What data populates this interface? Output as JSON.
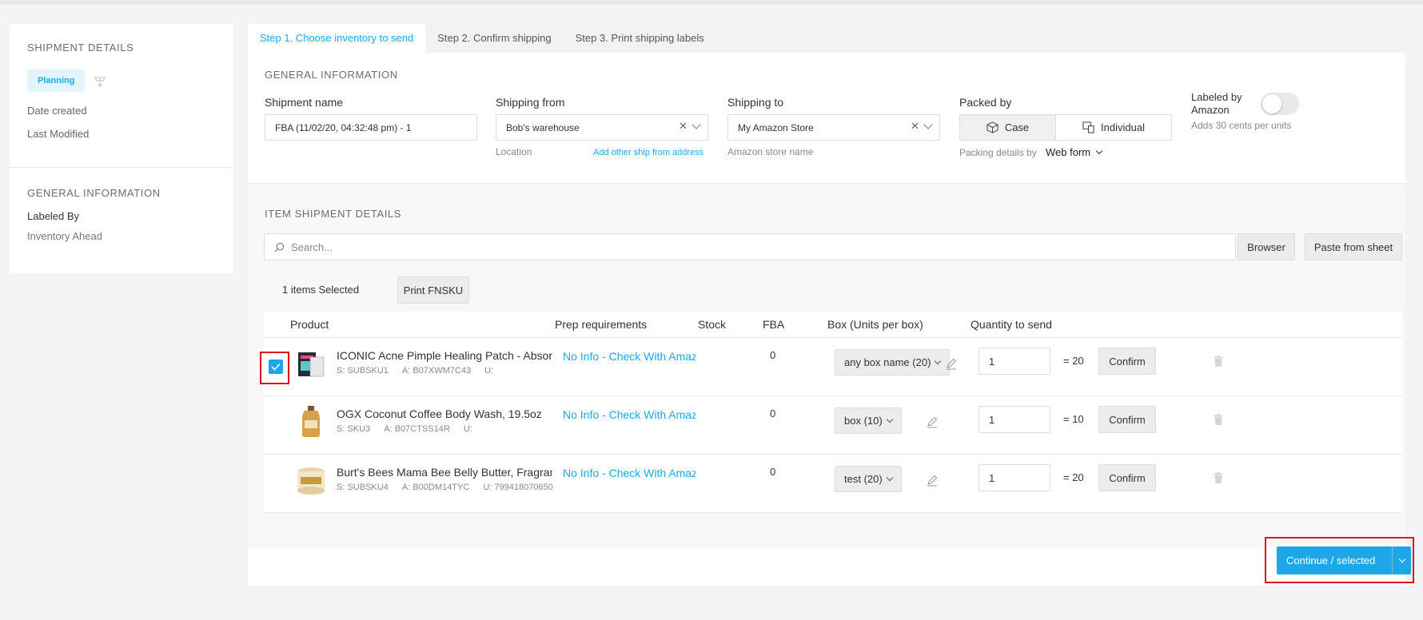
{
  "left_panel": {
    "shipment_details_title": "SHIPMENT DETAILS",
    "status_badge": "Planning",
    "date_created_label": "Date created",
    "last_modified_label": "Last Modified",
    "general_info_title": "GENERAL INFORMATION",
    "labeled_by_label": "Labeled By",
    "labeled_by_value": "Inventory Ahead"
  },
  "tabs": [
    {
      "label": "Step 1. Choose inventory to send",
      "active": true
    },
    {
      "label": "Step 2. Confirm shipping",
      "active": false
    },
    {
      "label": "Step 3. Print shipping labels",
      "active": false
    }
  ],
  "general": {
    "title": "GENERAL INFORMATION",
    "shipment_name_label": "Shipment name",
    "shipment_name_value": "FBA (11/02/20, 04:32:48 pm) - 1",
    "shipping_from_label": "Shipping from",
    "shipping_from_value": "Bob's warehouse",
    "shipping_from_sub": "Location",
    "add_ship_from_link": "Add other ship from address",
    "shipping_to_label": "Shipping to",
    "shipping_to_value": "My Amazon Store",
    "shipping_to_sub": "Amazon store name",
    "packed_by_label": "Packed by",
    "packed_case": "Case",
    "packed_individual": "Individual",
    "packing_details_label": "Packing details by",
    "packing_details_value": "Web form",
    "labeled_by_amazon_label": "Labeled by Amazon",
    "labeled_by_amazon_sub": "Adds 30 cents per units"
  },
  "items": {
    "title": "ITEM SHIPMENT DETAILS",
    "search_placeholder": "Search...",
    "browser_button": "Browser",
    "paste_button": "Paste from sheet",
    "selected_count": "1 items Selected",
    "print_fnsku_button": "Print FNSKU",
    "columns": {
      "product": "Product",
      "prep": "Prep requirements",
      "stock": "Stock",
      "fba": "FBA",
      "box": "Box (Units per box)",
      "qty": "Quantity to send"
    },
    "rows": [
      {
        "name": "ICONIC Acne Pimple Healing Patch - Absor",
        "sku": "S: SUBSKU1",
        "asin": "A: B07XWM7C43",
        "upc": "U:",
        "prep": "No Info - Check With Amaz",
        "fba": "0",
        "box": "any box name (20)",
        "qty": "1",
        "total": "= 20",
        "confirm": "Confirm",
        "checked": true
      },
      {
        "name": "OGX Coconut Coffee Body Wash, 19.5oz",
        "sku": "S: SKU3",
        "asin": "A: B07CTSS14R",
        "upc": "U:",
        "prep": "No Info - Check With Amaz",
        "fba": "0",
        "box": "box (10)",
        "qty": "1",
        "total": "= 10",
        "confirm": "Confirm",
        "checked": false
      },
      {
        "name": "Burt's Bees Mama Bee Belly Butter, Fragran",
        "sku": "S: SUBSKU4",
        "asin": "A: B00DM14TYC",
        "upc": "U: 799418070650",
        "prep": "No Info - Check With Amaz",
        "fba": "0",
        "box": "test (20)",
        "qty": "1",
        "total": "= 20",
        "confirm": "Confirm",
        "checked": false
      }
    ]
  },
  "footer": {
    "continue_label": "Continue / selected"
  },
  "colors": {
    "accent": "#1ea7e8",
    "highlight_outline": "#e0141d"
  }
}
